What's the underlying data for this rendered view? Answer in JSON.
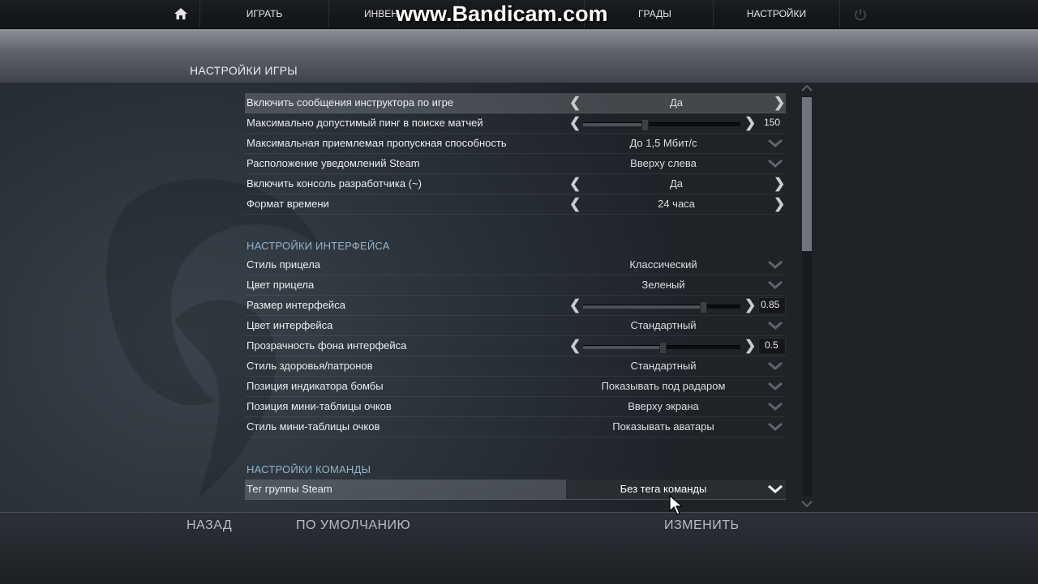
{
  "watermark": "www.Bandicam.com",
  "nav": {
    "home_icon": "home-icon",
    "items": [
      {
        "label": "ИГРАТЬ"
      },
      {
        "label": "ИНВЕН"
      },
      {
        "label": ""
      },
      {
        "label": "ГРАДЫ"
      },
      {
        "label": "НАСТРОЙКИ"
      }
    ],
    "power_icon": "power-icon"
  },
  "page_title": "НАСТРОЙКИ ИГРЫ",
  "game_settings": [
    {
      "label": "Включить сообщения инструктора по игре",
      "control": "arrows",
      "value": "Да",
      "highlight": true
    },
    {
      "label": "Максимально допустимый пинг в поиске матчей",
      "control": "slider",
      "value": "150",
      "level": 0.39
    },
    {
      "label": "Максимальная приемлемая пропускная способность",
      "control": "dropdown",
      "value": "До 1,5 Мбит/с"
    },
    {
      "label": "Расположение уведомлений Steam",
      "control": "dropdown",
      "value": "Вверху слева"
    },
    {
      "label": "Включить консоль разработчика (~)",
      "control": "arrows",
      "value": "Да"
    },
    {
      "label": "Формат времени",
      "control": "arrows",
      "value": "24 часа"
    }
  ],
  "interface_section": {
    "title": "НАСТРОЙКИ ИНТЕРФЕЙСА",
    "rows": [
      {
        "label": "Стиль прицела",
        "control": "dropdown",
        "value": "Классический"
      },
      {
        "label": "Цвет прицела",
        "control": "dropdown",
        "value": "Зеленый"
      },
      {
        "label": "Размер интерфейса",
        "control": "slider",
        "value": "0.85",
        "level": 0.75
      },
      {
        "label": "Цвет интерфейса",
        "control": "dropdown",
        "value": "Стандартный"
      },
      {
        "label": "Прозрачность фона интерфейса",
        "control": "slider",
        "value": "0.5",
        "level": 0.5
      },
      {
        "label": "Стиль здоровья/патронов",
        "control": "dropdown",
        "value": "Стандартный"
      },
      {
        "label": "Позиция индикатора бомбы",
        "control": "dropdown",
        "value": "Показывать под радаром"
      },
      {
        "label": "Позиция мини-таблицы очков",
        "control": "dropdown",
        "value": "Вверху экрана"
      },
      {
        "label": "Стиль мини-таблицы очков",
        "control": "dropdown",
        "value": "Показывать аватары"
      }
    ]
  },
  "team_section": {
    "title": "НАСТРОЙКИ КОМАНДЫ",
    "rows": [
      {
        "label": "Тег группы Steam",
        "control": "dropdown-active",
        "value": "Без тега команды",
        "highlight": true
      }
    ]
  },
  "bottom": {
    "back": "НАЗАД",
    "defaults": "ПО УМОЛЧАНИЮ",
    "apply": "ИЗМЕНИТЬ"
  },
  "colors": {
    "section_title": "#93b3c8",
    "text": "#eceeef",
    "highlight_row": "rgba(200,205,210,0.22)"
  }
}
